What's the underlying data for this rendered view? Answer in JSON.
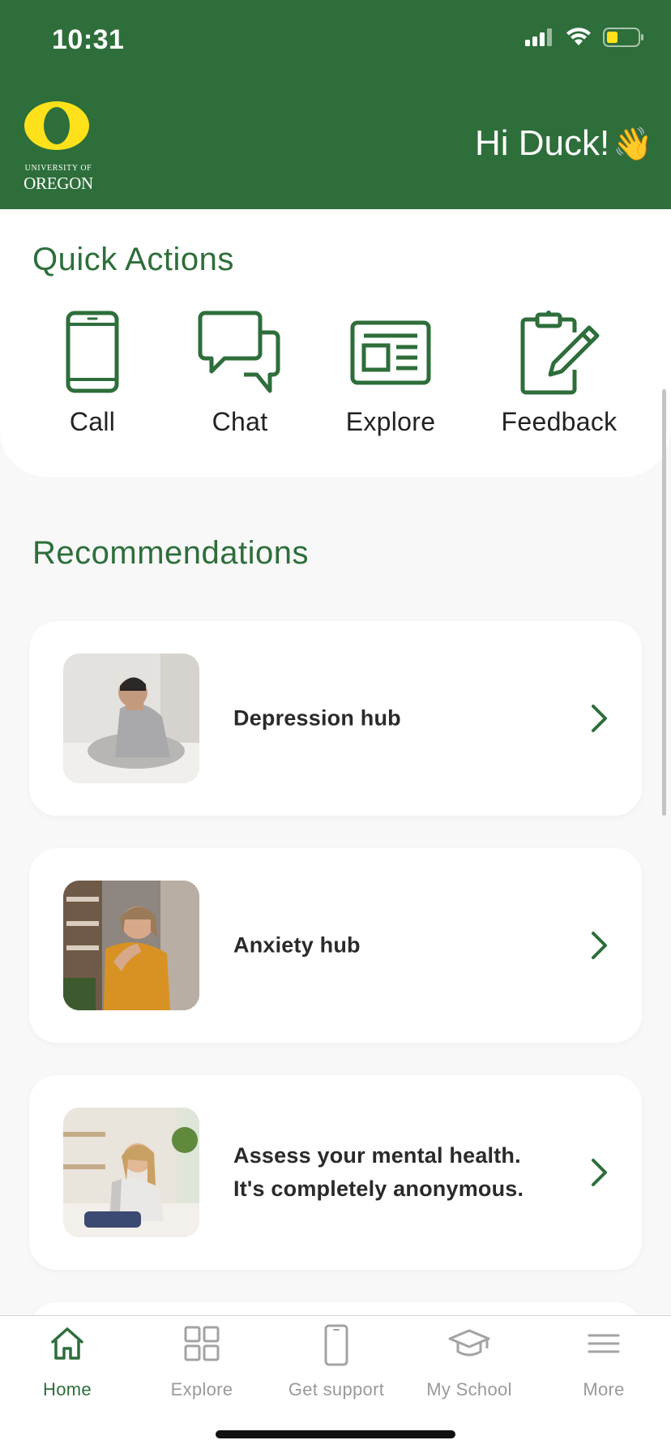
{
  "status": {
    "time": "10:31"
  },
  "header": {
    "logo": {
      "line1": "UNIVERSITY OF",
      "line2": "OREGON"
    },
    "greeting": "Hi Duck!",
    "greeting_emoji": "👋",
    "brand_color": "#2d6e3a",
    "logo_color": "#fee11a"
  },
  "quick_actions": {
    "title": "Quick Actions",
    "items": [
      {
        "label": "Call",
        "icon": "phone-icon"
      },
      {
        "label": "Chat",
        "icon": "chat-icon"
      },
      {
        "label": "Explore",
        "icon": "newspaper-icon"
      },
      {
        "label": "Feedback",
        "icon": "clipboard-pencil-icon"
      }
    ]
  },
  "recommendations": {
    "title": "Recommendations",
    "items": [
      {
        "text": "Depression hub"
      },
      {
        "text": "Anxiety hub"
      },
      {
        "line1": "Assess your mental health.",
        "line2": "It's completely anonymous."
      }
    ]
  },
  "tabbar": {
    "items": [
      {
        "label": "Home",
        "icon": "home-icon",
        "active": true
      },
      {
        "label": "Explore",
        "icon": "grid-icon",
        "active": false
      },
      {
        "label": "Get support",
        "icon": "phone-icon",
        "active": false
      },
      {
        "label": "My School",
        "icon": "graduation-cap-icon",
        "active": false
      },
      {
        "label": "More",
        "icon": "menu-icon",
        "active": false
      }
    ]
  }
}
